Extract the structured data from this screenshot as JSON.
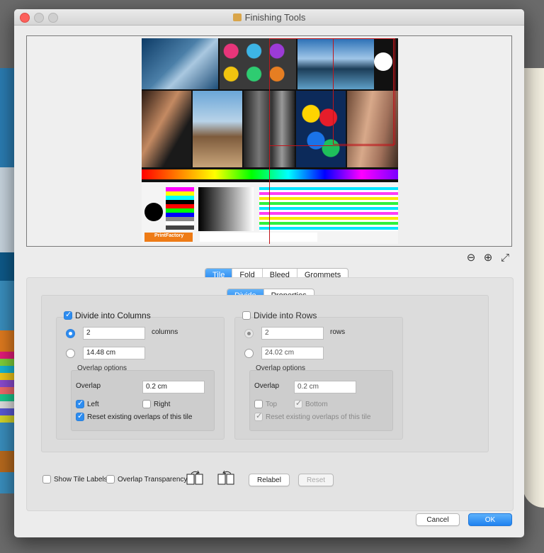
{
  "window": {
    "title": "Finishing Tools"
  },
  "preview": {
    "brand_label": "PrintFactory"
  },
  "zoom": {
    "zoom_out_icon": "zoom-out-icon",
    "zoom_in_icon": "zoom-in-icon",
    "fit_icon": "fit-screen-icon"
  },
  "main_tabs": [
    "Tile",
    "Fold",
    "Bleed",
    "Grommets"
  ],
  "sub_tabs": [
    "Divide",
    "Properties"
  ],
  "columns": {
    "title": "Divide into Columns",
    "checked": true,
    "count": "2",
    "count_unit": "columns",
    "width": "14.48 cm",
    "overlap_title": "Overlap options",
    "overlap_label": "Overlap",
    "overlap_value": "0.2 cm",
    "left_label": "Left",
    "right_label": "Right",
    "reset_label": "Reset existing overlaps of this tile"
  },
  "rows": {
    "title": "Divide into Rows",
    "checked": false,
    "count": "2",
    "count_unit": "rows",
    "height": "24.02 cm",
    "overlap_title": "Overlap options",
    "overlap_label": "Overlap",
    "overlap_value": "0.2 cm",
    "top_label": "Top",
    "bottom_label": "Bottom",
    "reset_label": "Reset existing overlaps of this tile"
  },
  "bottom": {
    "show_labels": "Show Tile Labels",
    "overlap_transparency": "Overlap Transparency",
    "relabel": "Relabel",
    "reset": "Reset"
  },
  "dialog": {
    "cancel": "Cancel",
    "ok": "OK"
  },
  "colors": {
    "accent": "#2d8cf0",
    "guide": "#c0151b"
  }
}
